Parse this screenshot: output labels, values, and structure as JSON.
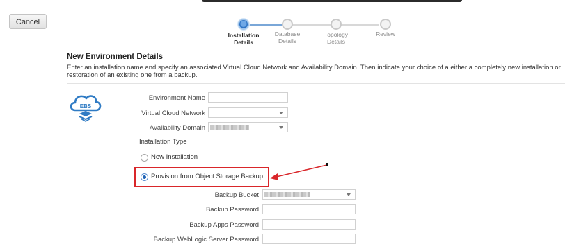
{
  "toolbar": {
    "cancel_label": "Cancel"
  },
  "train": {
    "steps": [
      {
        "label_line1": "Installation",
        "label_line2": "Details",
        "state": "active"
      },
      {
        "label_line1": "Database",
        "label_line2": "Details",
        "state": "pending"
      },
      {
        "label_line1": "Topology",
        "label_line2": "Details",
        "state": "pending"
      },
      {
        "label_line1": "Review",
        "label_line2": "",
        "state": "pending"
      }
    ]
  },
  "section": {
    "title": "New Environment Details",
    "description": "Enter an installation name and specify an associated Virtual Cloud Network and Availability Domain. Then indicate your choice of a either a completely new installation or restoration of an existing one from a backup."
  },
  "icon": {
    "name": "ebs-cloud-icon",
    "text": "EBS",
    "color": "#2f7bc4"
  },
  "form": {
    "environment_name": {
      "label": "Environment Name",
      "value": ""
    },
    "virtual_cloud_network": {
      "label": "Virtual Cloud Network",
      "value": ""
    },
    "availability_domain": {
      "label": "Availability Domain",
      "value": ""
    },
    "installation_type": {
      "label": "Installation Type",
      "options": [
        {
          "label": "New Installation",
          "checked": false
        },
        {
          "label": "Provision from Object Storage Backup",
          "checked": true
        }
      ]
    },
    "backup_bucket": {
      "label": "Backup Bucket",
      "value": ""
    },
    "backup_password": {
      "label": "Backup Password",
      "value": ""
    },
    "backup_apps_password": {
      "label": "Backup Apps Password",
      "value": ""
    },
    "backup_weblogic_password": {
      "label": "Backup WebLogic Server Password",
      "value": ""
    }
  },
  "colors": {
    "accent": "#2e74c5",
    "annotation_red": "#d9262a"
  }
}
